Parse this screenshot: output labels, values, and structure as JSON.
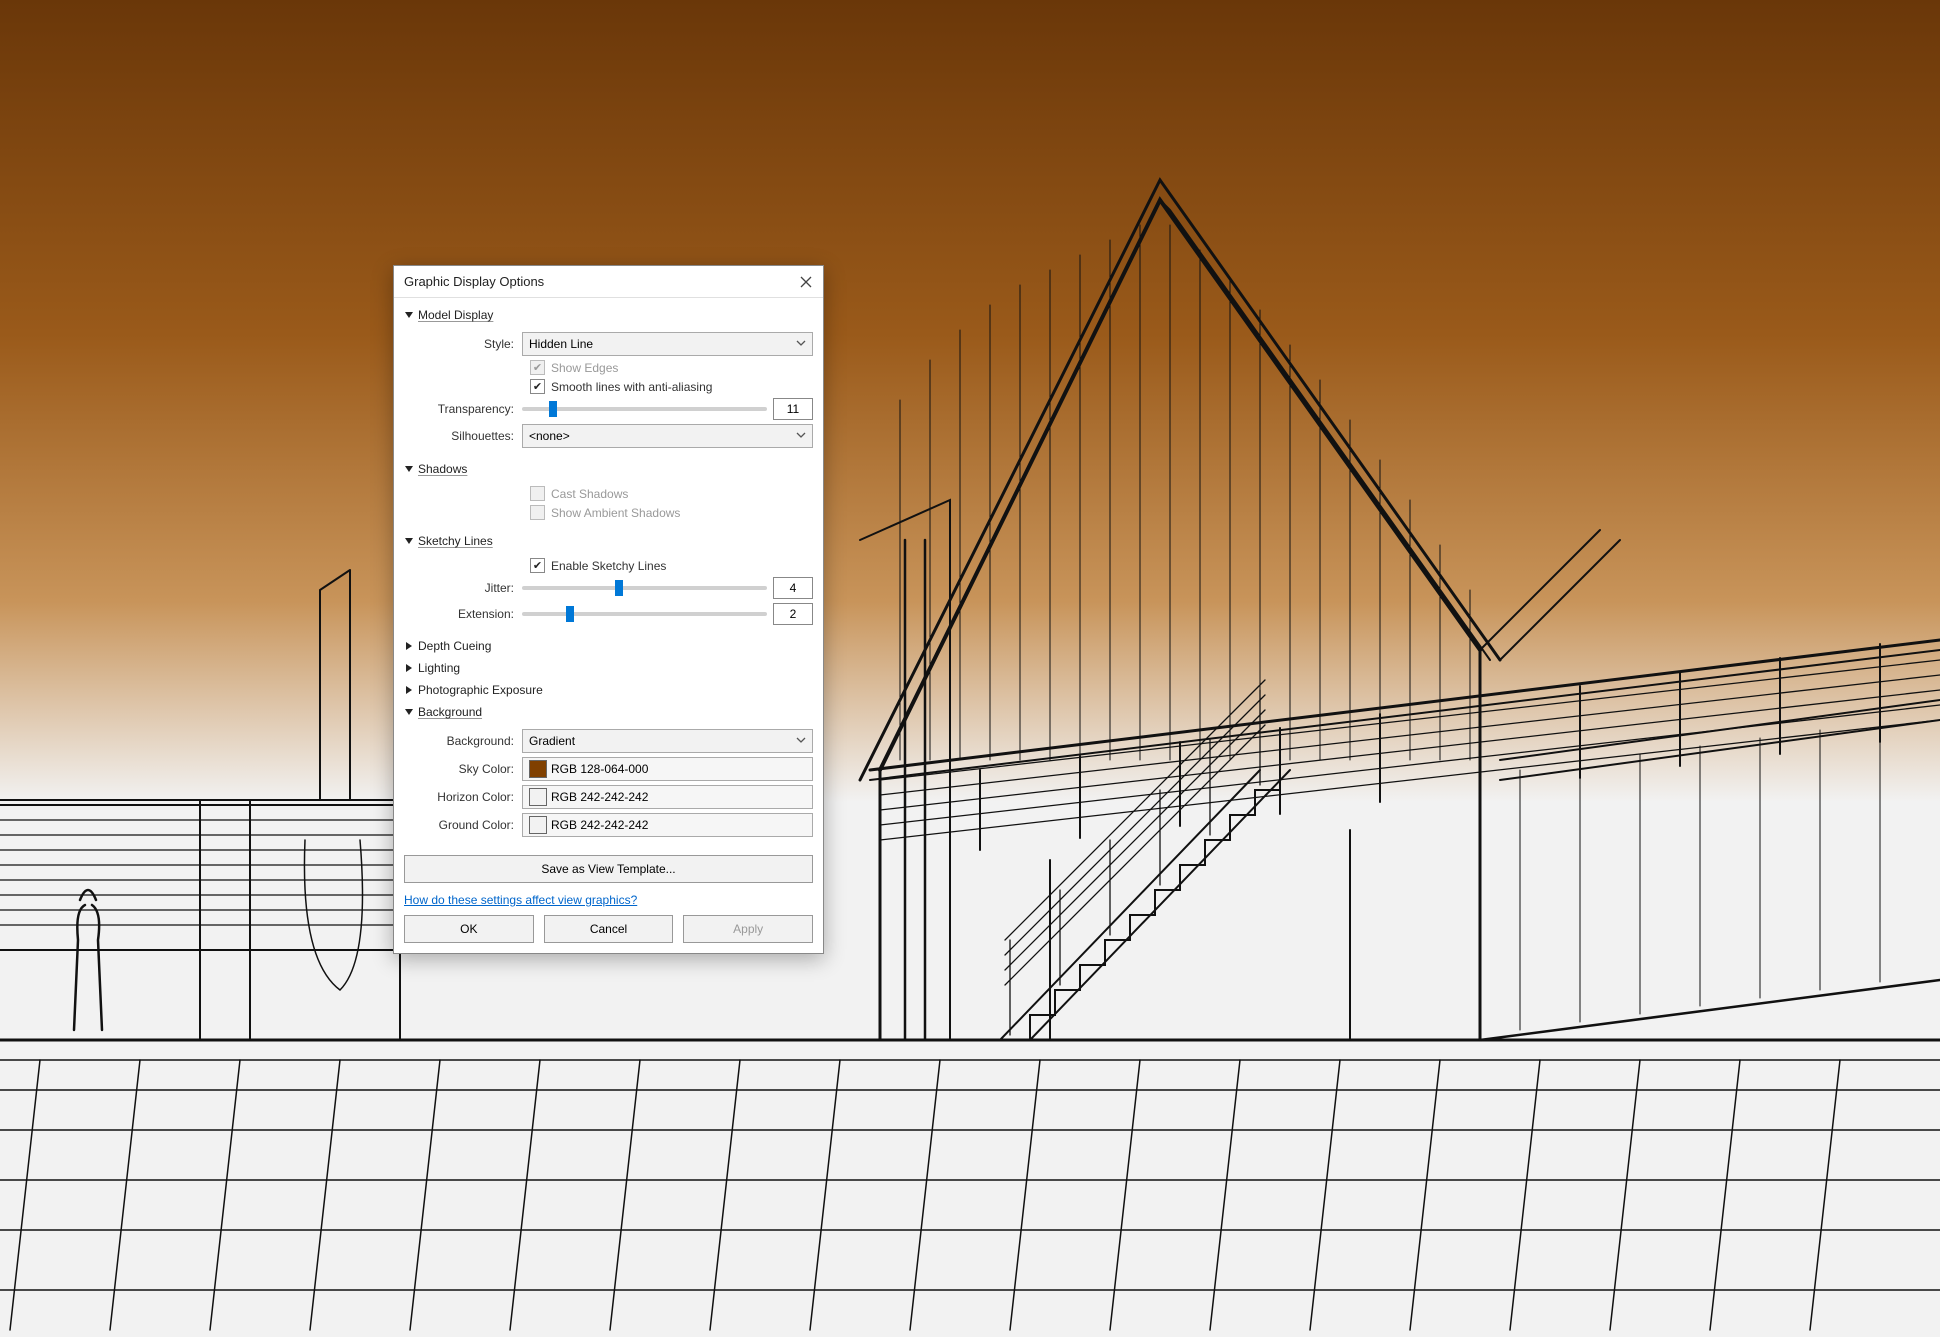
{
  "dialog": {
    "title": "Graphic Display Options",
    "sections": {
      "model_display": {
        "header": "Model Display",
        "style_label": "Style:",
        "style_value": "Hidden Line",
        "show_edges_label": "Show Edges",
        "smooth_lines_label": "Smooth lines with anti-aliasing",
        "transparency_label": "Transparency:",
        "transparency_value": "11",
        "silhouettes_label": "Silhouettes:",
        "silhouettes_value": "<none>"
      },
      "shadows": {
        "header": "Shadows",
        "cast_label": "Cast Shadows",
        "ambient_label": "Show Ambient Shadows"
      },
      "sketchy": {
        "header": "Sketchy Lines",
        "enable_label": "Enable Sketchy Lines",
        "jitter_label": "Jitter:",
        "jitter_value": "4",
        "extension_label": "Extension:",
        "extension_value": "2"
      },
      "depth_cueing": {
        "header": "Depth Cueing"
      },
      "lighting": {
        "header": "Lighting"
      },
      "photo_exposure": {
        "header": "Photographic Exposure"
      },
      "background": {
        "header": "Background",
        "background_label": "Background:",
        "background_value": "Gradient",
        "sky_label": "Sky Color:",
        "sky_value": "RGB 128-064-000",
        "sky_hex": "#804000",
        "horizon_label": "Horizon Color:",
        "horizon_value": "RGB 242-242-242",
        "horizon_hex": "#f2f2f2",
        "ground_label": "Ground Color:",
        "ground_value": "RGB 242-242-242",
        "ground_hex": "#f2f2f2"
      }
    },
    "save_template_label": "Save as View Template...",
    "help_link": "How do these settings affect view graphics?",
    "ok_label": "OK",
    "cancel_label": "Cancel",
    "apply_label": "Apply"
  }
}
